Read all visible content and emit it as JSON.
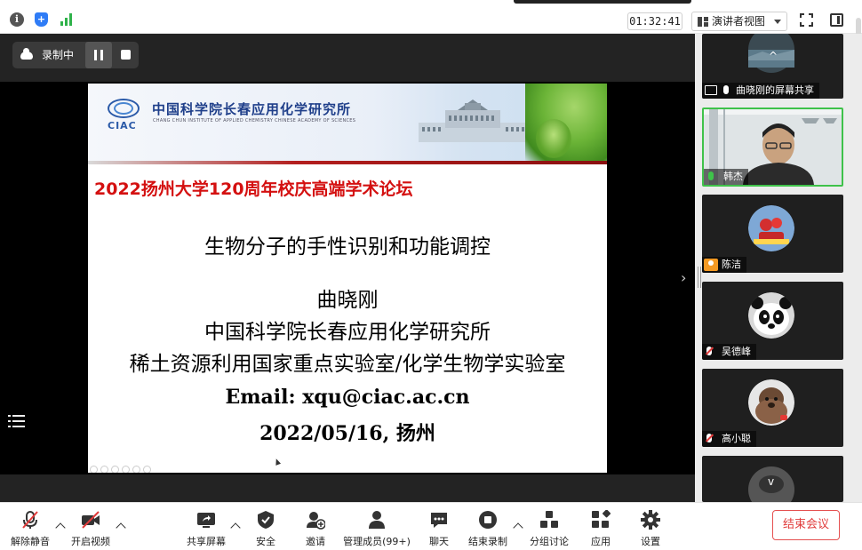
{
  "topbar": {
    "timer": "01:32:41",
    "view_mode": "演讲者视图"
  },
  "recording": {
    "status": "录制中"
  },
  "slide": {
    "institute_cn": "中国科学院长春应用化学研究所",
    "institute_en": "CHANG CHUN INSTITUTE OF APPLIED CHEMISTRY CHINESE ACADEMY OF SCIENCES",
    "logo_text": "CIAC",
    "forum": "2022扬州大学120周年校庆高端学术论坛",
    "title": "生物分子的手性识别和功能调控",
    "speaker": "曲晓刚",
    "affiliation1": "中国科学院长春应用化学研究所",
    "affiliation2": "稀土资源利用国家重点实验室/化学生物学实验室",
    "email": "Email: xqu@ciac.ac.cn",
    "date_place": "2022/05/16, 扬州"
  },
  "participants": [
    {
      "name": "曲晓刚的屏幕共享",
      "mic": "on",
      "type": "screen"
    },
    {
      "name": "韩杰",
      "mic": "speaking",
      "type": "video"
    },
    {
      "name": "陈洁",
      "mic": "none",
      "type": "avatar"
    },
    {
      "name": "吴德峰",
      "mic": "muted",
      "type": "avatar"
    },
    {
      "name": "高小聪",
      "mic": "muted",
      "type": "avatar"
    }
  ],
  "toolbar": {
    "mute": "解除静音",
    "video": "开启视频",
    "share": "共享屏幕",
    "security": "安全",
    "invite": "邀请",
    "members": "管理成员(99+)",
    "chat": "聊天",
    "end_recording": "结束录制",
    "breakout": "分组讨论",
    "apps": "应用",
    "settings": "设置",
    "end_meeting": "结束会议"
  },
  "colors": {
    "forum_red": "#d41010",
    "speaking_green": "#3fc24a",
    "end_red": "#e03b3b"
  }
}
